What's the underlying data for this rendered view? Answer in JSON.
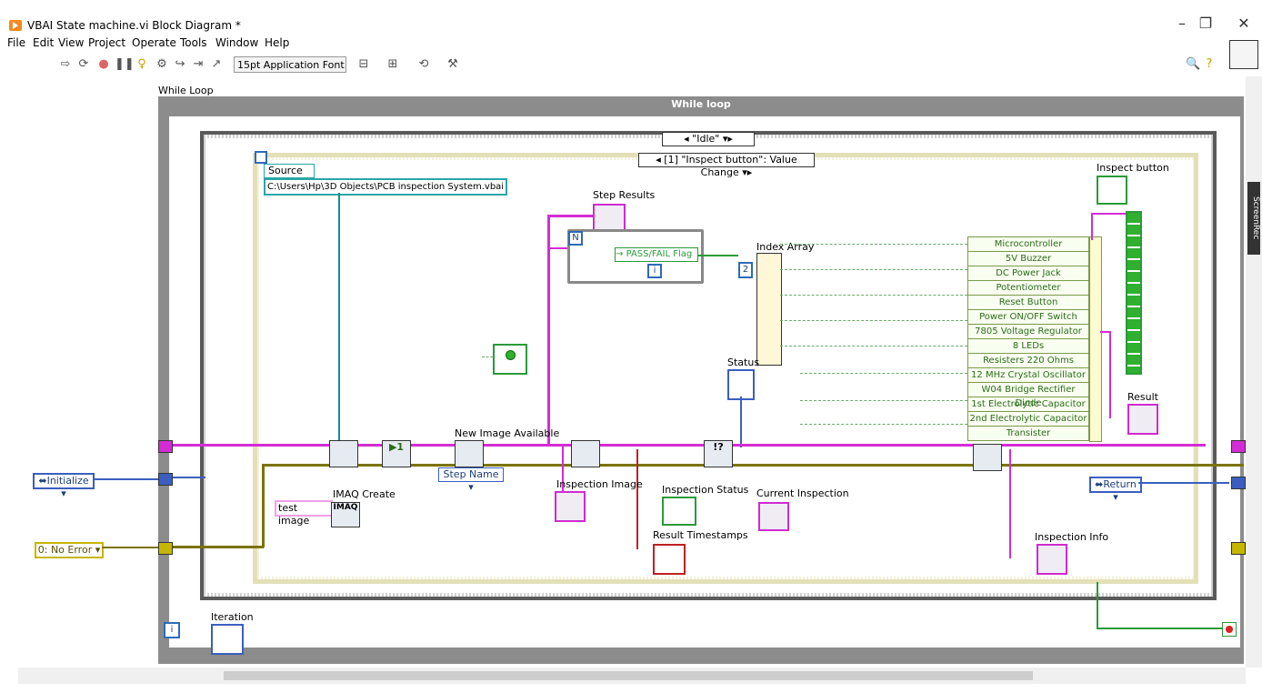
{
  "window": {
    "title": "VBAI State machine.vi Block Diagram *",
    "minimize": "–",
    "restore": "❐",
    "close": "✕"
  },
  "menu": [
    "File",
    "Edit",
    "View",
    "Project",
    "Operate",
    "Tools",
    "Window",
    "Help"
  ],
  "toolbar": {
    "font": "15pt Application Font",
    "search_icon": "search-icon",
    "help_icon": "help-icon"
  },
  "diagram": {
    "while_loop_label": "While Loop",
    "while_loop_title": "While loop",
    "case_selector": "\"Idle\"",
    "event_selector": "[1] \"Inspect button\": Value Change",
    "source_label": "Source",
    "source_path": "C:\\Users\\Hp\\3D Objects\\PCB inspection System.vbai",
    "step_results": "Step Results",
    "pass_fail": "PASS/FAIL Flag",
    "index_array": "Index Array",
    "index_value": "2",
    "status": "Status",
    "new_image": "New Image Available",
    "imaq_create": "IMAQ Create",
    "imaq_text": "IMAQ",
    "test_image": "test image",
    "step_name": "Step Name",
    "inspection_image": "Inspection Image",
    "inspection_status": "Inspection Status",
    "current_inspection": "Current Inspection",
    "result_timestamps": "Result Timestamps",
    "inspection_info": "Inspection Info",
    "inspect_button": "Inspect button",
    "result": "Result",
    "return": "Return",
    "initialize": "Initialize",
    "no_error": "0: No Error",
    "iteration": "Iteration",
    "n_terminal": "N",
    "i_terminal": "i",
    "qbool": "!?"
  },
  "components": [
    "Microcontroller",
    "5V Buzzer",
    "DC Power Jack",
    "Potentiometer",
    "Reset Button",
    "Power ON/OFF Switch",
    "7805 Voltage Regulator",
    "8 LEDs",
    "Resisters 220 Ohms",
    "12 MHz Crystal Oscillator",
    "W04 Bridge Rectifier Diode",
    "1st Electrolytic Capacitor",
    "2nd Electrolytic Capacitor",
    "Transister"
  ],
  "colors": {
    "error_wire": "#7b7300",
    "string_wire": "#d42cd4",
    "bool_wire": "#2a9a3a",
    "enum_wire": "#3b5fc0"
  }
}
